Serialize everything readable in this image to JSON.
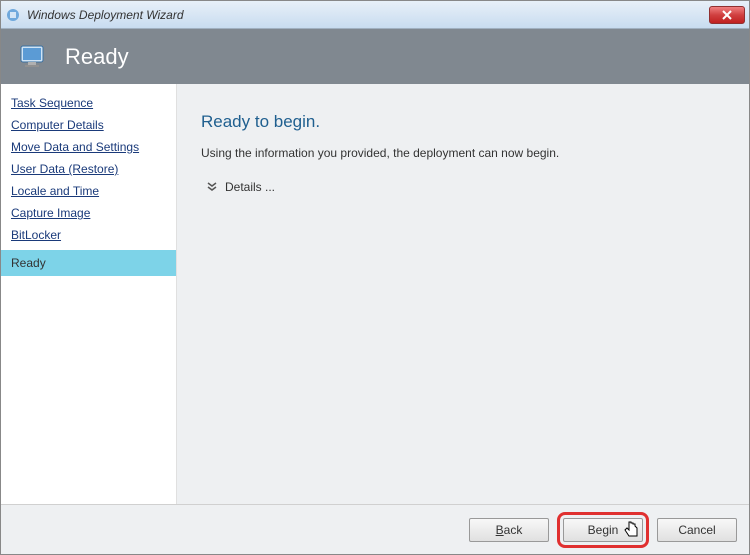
{
  "window": {
    "title": "Windows Deployment Wizard"
  },
  "banner": {
    "title": "Ready"
  },
  "sidebar": {
    "links": [
      "Task Sequence",
      "Computer Details",
      "Move Data and Settings",
      "User Data (Restore)",
      "Locale and Time",
      "Capture Image",
      "BitLocker"
    ],
    "active": "Ready"
  },
  "main": {
    "heading": "Ready to begin.",
    "description": "Using the information you provided, the deployment can now begin.",
    "details_label": "Details ..."
  },
  "buttons": {
    "back": "Back",
    "begin": "Begin",
    "cancel": "Cancel"
  }
}
